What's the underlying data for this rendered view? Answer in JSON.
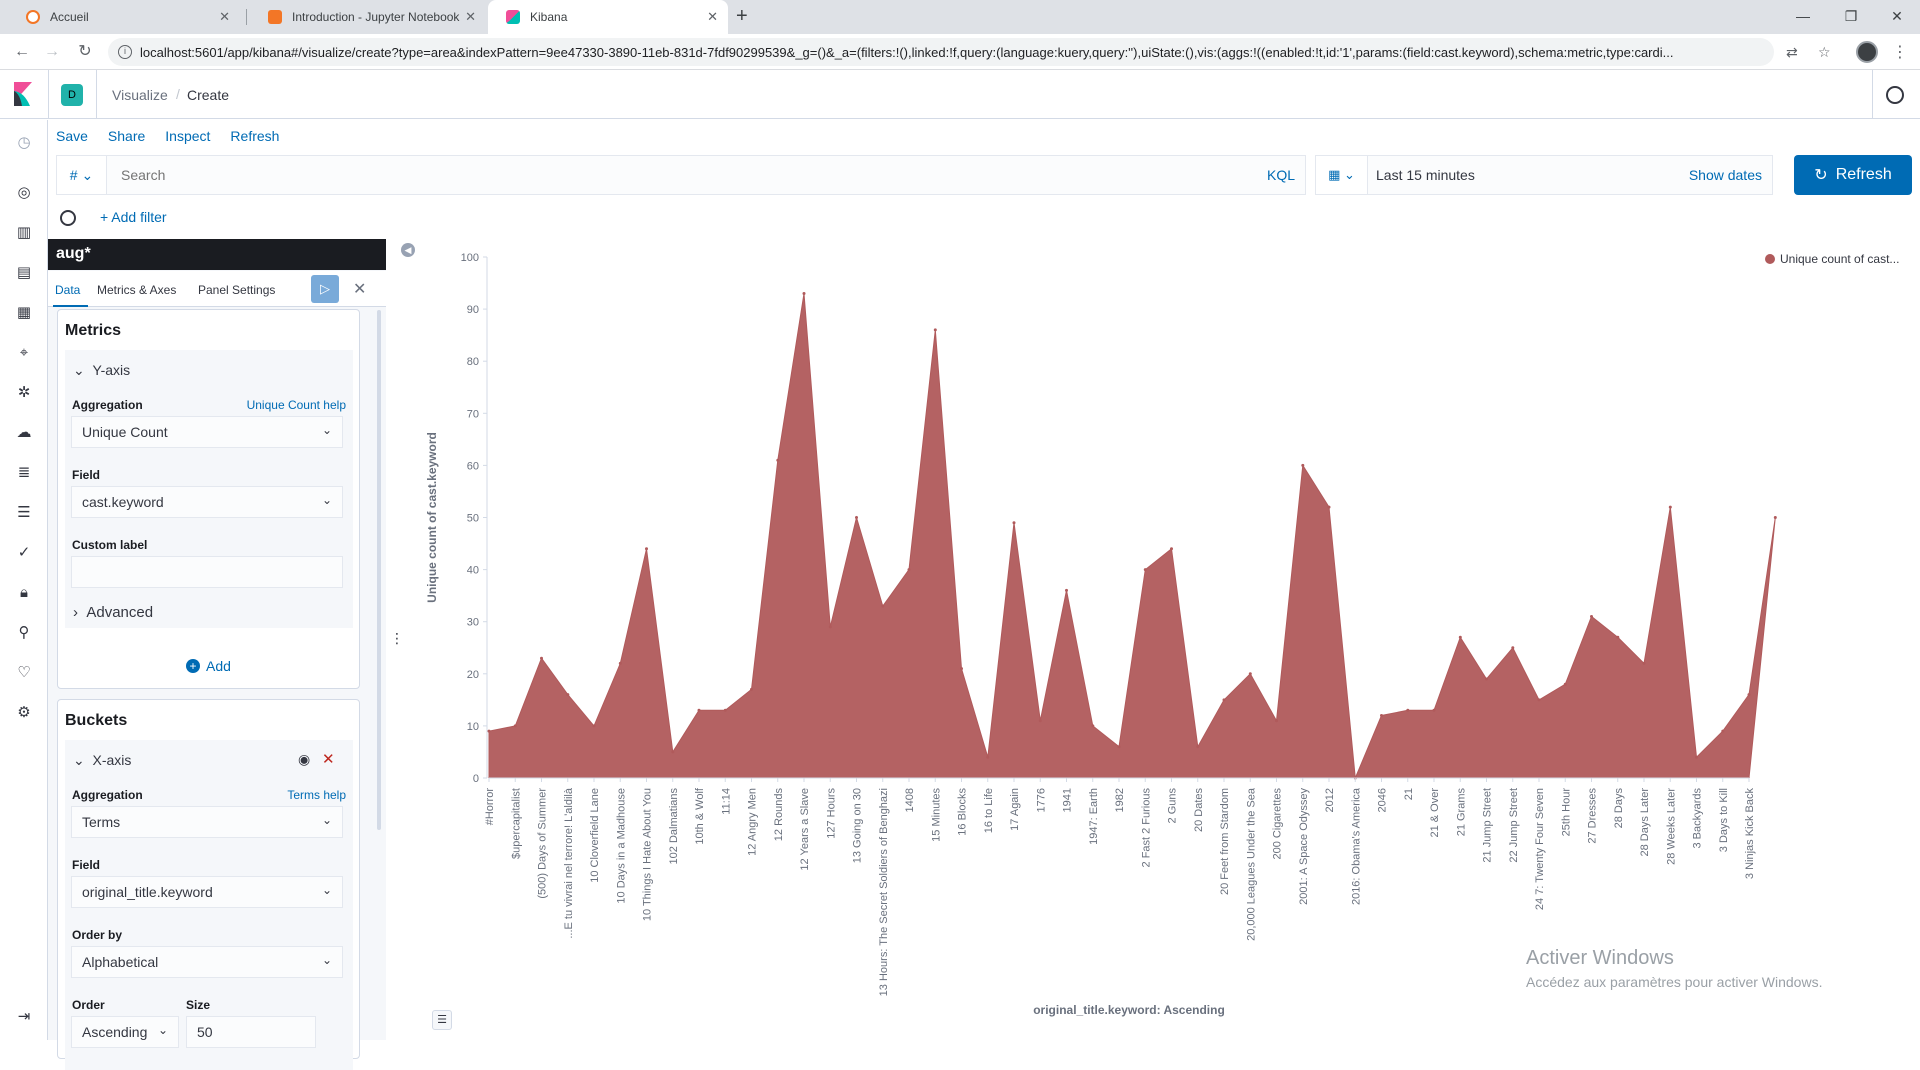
{
  "browser": {
    "tabs": [
      {
        "title": "Accueil",
        "active": false
      },
      {
        "title": "Introduction - Jupyter Notebook",
        "active": false
      },
      {
        "title": "Kibana",
        "active": true
      }
    ],
    "url": "localhost:5601/app/kibana#/visualize/create?type=area&indexPattern=9ee47330-3890-11eb-831d-7fdf90299539&_g=()&_a=(filters:!(),linked:!f,query:(language:kuery,query:''),uiState:(),vis:(aggs:!((enabled:!t,id:'1',params:(field:cast.keyword),schema:metric,type:cardi..."
  },
  "header": {
    "space_initial": "D",
    "breadcrumb_app": "Visualize",
    "breadcrumb_sep": "/",
    "breadcrumb_page": "Create"
  },
  "top_menu": {
    "save": "Save",
    "share": "Share",
    "inspect": "Inspect",
    "refresh": "Refresh"
  },
  "query_bar": {
    "lang_symbol": "#",
    "search_placeholder": "Search",
    "kql": "KQL",
    "date_range": "Last 15 minutes",
    "show_dates": "Show dates",
    "refresh_button": "Refresh",
    "add_filter": "+ Add filter"
  },
  "editor": {
    "index_pattern": "aug*",
    "tabs": [
      "Data",
      "Metrics & Axes",
      "Panel Settings"
    ],
    "metrics": {
      "title": "Metrics",
      "agg_title": "Y-axis",
      "aggregation_label": "Aggregation",
      "aggregation_help": "Unique Count help",
      "aggregation_value": "Unique Count",
      "field_label": "Field",
      "field_value": "cast.keyword",
      "custom_label": "Custom label",
      "custom_value": "",
      "advanced": "Advanced",
      "add": "Add"
    },
    "buckets": {
      "title": "Buckets",
      "agg_title": "X-axis",
      "aggregation_label": "Aggregation",
      "aggregation_help": "Terms help",
      "aggregation_value": "Terms",
      "field_label": "Field",
      "field_value": "original_title.keyword",
      "order_by_label": "Order by",
      "order_by_value": "Alphabetical",
      "order_label": "Order",
      "order_value": "Ascending",
      "size_label": "Size",
      "size_value": "50"
    }
  },
  "watermark": {
    "line1": "Activer Windows",
    "line2": "Accédez aux paramètres pour activer Windows."
  },
  "colors": {
    "series": "#b05a5b",
    "accent": "#006bb4",
    "space": "#20b2aa"
  },
  "chart_data": {
    "type": "area",
    "xlabel": "original_title.keyword: Ascending",
    "ylabel": "Unique count of cast.keyword",
    "ylim": [
      0,
      100
    ],
    "yticks": [
      0,
      10,
      20,
      30,
      40,
      50,
      60,
      70,
      80,
      90,
      100
    ],
    "legend": "top-right",
    "categories": [
      "#Horror",
      "$upercapitalist",
      "(500) Days of Summer",
      "...E tu vivrai nel terrore! L'aldilà",
      "10 Cloverfield Lane",
      "10 Days in a Madhouse",
      "10 Things I Hate About You",
      "102 Dalmatians",
      "10th & Wolf",
      "11:14",
      "12 Angry Men",
      "12 Rounds",
      "12 Years a Slave",
      "127 Hours",
      "13 Going on 30",
      "13 Hours: The Secret Soldiers of Benghazi",
      "1408",
      "15 Minutes",
      "16 Blocks",
      "16 to Life",
      "17 Again",
      "1776",
      "1941",
      "1947: Earth",
      "1982",
      "2 Fast 2 Furious",
      "2 Guns",
      "20 Dates",
      "20 Feet from Stardom",
      "20,000 Leagues Under the Sea",
      "200 Cigarettes",
      "2001: A Space Odyssey",
      "2012",
      "2016: Obama's America",
      "2046",
      "21",
      "21 & Over",
      "21 Grams",
      "21 Jump Street",
      "22 Jump Street",
      "24 7: Twenty Four Seven",
      "25th Hour",
      "27 Dresses",
      "28 Days",
      "28 Days Later",
      "28 Weeks Later",
      "3 Backyards",
      "3 Days to Kill",
      "3 Ninjas Kick Back"
    ],
    "series": [
      {
        "name": "Unique count of cast...",
        "values": [
          9,
          10,
          23,
          16,
          10,
          22,
          44,
          5,
          13,
          13,
          17,
          61,
          93,
          29,
          50,
          33,
          40,
          86,
          21,
          4,
          49,
          11,
          36,
          10,
          6,
          40,
          44,
          6,
          15,
          20,
          11,
          60,
          52,
          0,
          12,
          13,
          13,
          27,
          19,
          25,
          15,
          18,
          31,
          27,
          22,
          52,
          4,
          9,
          16,
          50
        ]
      }
    ]
  }
}
